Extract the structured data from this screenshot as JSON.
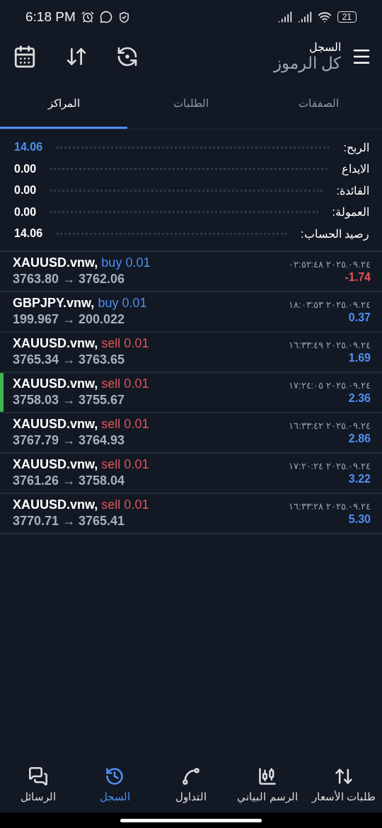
{
  "status_bar": {
    "time": "6:18 PM",
    "battery": "21"
  },
  "header": {
    "title": "السجل",
    "subtitle": "كل الرموز"
  },
  "tabs": [
    {
      "label": "الصفقات",
      "selected": false
    },
    {
      "label": "الطلبات",
      "selected": false
    },
    {
      "label": "المراكز",
      "selected": true
    }
  ],
  "summary": [
    {
      "label": "الربح:",
      "value": "14.06",
      "accent": true
    },
    {
      "label": "الايداع",
      "value": "0.00",
      "accent": false
    },
    {
      "label": "الفائدة:",
      "value": "0.00",
      "accent": false
    },
    {
      "label": "العمولة:",
      "value": "0.00",
      "accent": false
    },
    {
      "label": "رصيد الحساب:",
      "value": "14.06",
      "accent": false
    }
  ],
  "trades": [
    {
      "symbol": "XAUUSD.vnw,",
      "kind": "buy",
      "order": "buy 0.01",
      "prices": "3763.80 → 3762.06",
      "time": "٢٠٢٥.٠٩.٢٤ ٠٢:٥٢:٤٨",
      "profit": "-1.74",
      "loss": true,
      "selected": false
    },
    {
      "symbol": "GBPJPY.vnw,",
      "kind": "buy",
      "order": "buy 0.01",
      "prices": "199.967 → 200.022",
      "time": "٢٠٢٥.٠٩.٢٤ ١٨:٠٣:٥٣",
      "profit": "0.37",
      "loss": false,
      "selected": false
    },
    {
      "symbol": "XAUUSD.vnw,",
      "kind": "sell",
      "order": "sell 0.01",
      "prices": "3765.34 → 3763.65",
      "time": "٢٠٢٥.٠٩.٢٤ ١٦:٣٣:٤٩",
      "profit": "1.69",
      "loss": false,
      "selected": false
    },
    {
      "symbol": "XAUUSD.vnw,",
      "kind": "sell",
      "order": "sell 0.01",
      "prices": "3758.03 → 3755.67",
      "time": "٢٠٢٥.٠٩.٢٤ ١٧:٢٤:٠٥",
      "profit": "2.36",
      "loss": false,
      "selected": true
    },
    {
      "symbol": "XAUUSD.vnw,",
      "kind": "sell",
      "order": "sell 0.01",
      "prices": "3767.79 → 3764.93",
      "time": "٢٠٢٥.٠٩.٢٤ ١٦:٣٣:٤٢",
      "profit": "2.86",
      "loss": false,
      "selected": false
    },
    {
      "symbol": "XAUUSD.vnw,",
      "kind": "sell",
      "order": "sell 0.01",
      "prices": "3761.26 → 3758.04",
      "time": "٢٠٢٥.٠٩.٢٤ ١٧:٢٠:٢٤",
      "profit": "3.22",
      "loss": false,
      "selected": false
    },
    {
      "symbol": "XAUUSD.vnw,",
      "kind": "sell",
      "order": "sell 0.01",
      "prices": "3770.71 → 3765.41",
      "time": "٢٠٢٥.٠٩.٢٤ ١٦:٣٣:٢٨",
      "profit": "5.30",
      "loss": false,
      "selected": false
    }
  ],
  "bottom_nav": [
    {
      "label": "طلبات الأسعار",
      "kind": "quotes",
      "selected": false
    },
    {
      "label": "الرسم البياني",
      "kind": "chart",
      "selected": false
    },
    {
      "label": "التداول",
      "kind": "trade",
      "selected": false
    },
    {
      "label": "السجل",
      "kind": "history",
      "selected": true
    },
    {
      "label": "الرسائل",
      "kind": "messages",
      "selected": false
    }
  ]
}
